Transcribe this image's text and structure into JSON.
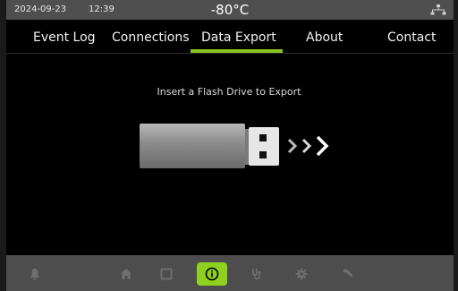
{
  "status": {
    "date": "2024-09-23",
    "time": "12:39",
    "temperature": "-80°C",
    "network_icon": "network-icon"
  },
  "tabs": [
    {
      "label": "Event Log"
    },
    {
      "label": "Connections"
    },
    {
      "label": "Data Export",
      "active": true
    },
    {
      "label": "About"
    },
    {
      "label": "Contact"
    }
  ],
  "main": {
    "message": "Insert a Flash Drive to Export",
    "illustration": "usb-drive-icon"
  },
  "bottom_nav": [
    {
      "icon": "bell-icon"
    },
    {
      "icon": "home-icon"
    },
    {
      "icon": "square-icon"
    },
    {
      "icon": "info-icon",
      "active": true
    },
    {
      "icon": "stethoscope-icon"
    },
    {
      "icon": "gear-icon"
    },
    {
      "icon": "wrench-icon"
    }
  ],
  "colors": {
    "accent": "#86c51f",
    "active_button": "#8fd11f",
    "statusbar": "#4f4f4f",
    "bottombar": "#4d4d4d"
  }
}
